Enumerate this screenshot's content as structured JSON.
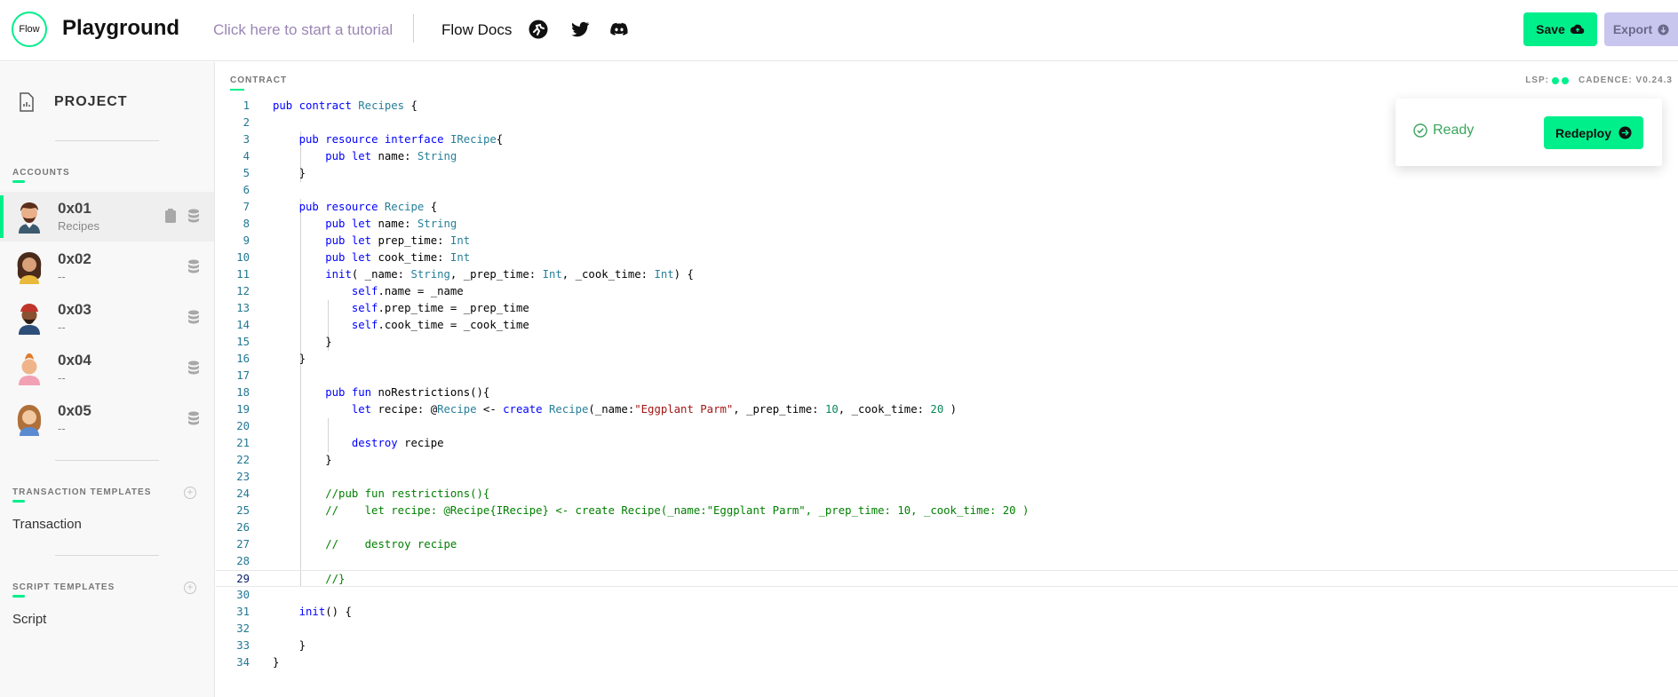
{
  "header": {
    "logo_text": "Flow",
    "title": "Playground",
    "tutorial_link": "Click here to start a tutorial",
    "docs_link": "Flow Docs",
    "icons": [
      "flow-runner-icon",
      "twitter-icon",
      "discord-icon"
    ],
    "save_label": "Save",
    "export_label": "Export"
  },
  "sidebar": {
    "project_label": "PROJECT",
    "accounts_title": "ACCOUNTS",
    "accounts": [
      {
        "address": "0x01",
        "sub": "Recipes",
        "active": true
      },
      {
        "address": "0x02",
        "sub": "--",
        "active": false
      },
      {
        "address": "0x03",
        "sub": "--",
        "active": false
      },
      {
        "address": "0x04",
        "sub": "--",
        "active": false
      },
      {
        "address": "0x05",
        "sub": "--",
        "active": false
      }
    ],
    "transaction_templates_title": "TRANSACTION TEMPLATES",
    "transaction_item": "Transaction",
    "script_templates_title": "SCRIPT TEMPLATES",
    "script_item": "Script"
  },
  "editor": {
    "label": "CONTRACT",
    "lsp_label": "LSP:",
    "cadence_label": "CADENCE: V0.24.3",
    "current_line": 29,
    "lines": [
      "pub contract Recipes {",
      "",
      "    pub resource interface IRecipe{",
      "        pub let name: String",
      "    }",
      "",
      "    pub resource Recipe {",
      "        pub let name: String",
      "        pub let prep_time: Int",
      "        pub let cook_time: Int",
      "        init( _name: String, _prep_time: Int, _cook_time: Int) {",
      "            self.name = _name",
      "            self.prep_time = _prep_time",
      "            self.cook_time = _cook_time",
      "        }",
      "    }",
      "",
      "        pub fun noRestrictions(){",
      "            let recipe: @Recipe <- create Recipe(_name:\"Eggplant Parm\", _prep_time: 10, _cook_time: 20 )",
      "",
      "            destroy recipe",
      "        }",
      "",
      "        //pub fun restrictions(){",
      "        //    let recipe: @Recipe{IRecipe} <- create Recipe(_name:\"Eggplant Parm\", _prep_time: 10, _cook_time: 20 )",
      "",
      "        //    destroy recipe",
      "",
      "        //}",
      "",
      "    init() {",
      "",
      "    }",
      "}"
    ]
  },
  "deploy": {
    "status": "Ready",
    "redeploy_label": "Redeploy"
  },
  "colors": {
    "accent": "#00ef8b",
    "export_bg": "#c8c6ee",
    "tutorial_link": "#9b86b4",
    "ready": "#3aa55d"
  }
}
